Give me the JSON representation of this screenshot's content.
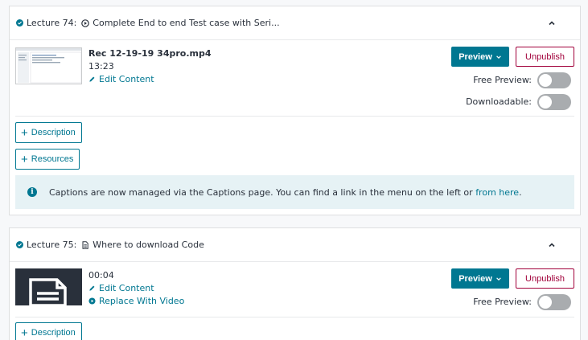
{
  "lectures": [
    {
      "number_label": "Lecture 74:",
      "title": "Complete End to end Test case with Seri...",
      "file_name": "Rec 12-19-19 34pro.mp4",
      "duration": "13:23",
      "edit_label": "Edit Content",
      "preview_label": "Preview",
      "unpublish_label": "Unpublish",
      "free_preview_label": "Free Preview:",
      "downloadable_label": "Downloadable:",
      "description_label": "Description",
      "resources_label": "Resources",
      "info": {
        "text_before": "Captions are now managed via the Captions page. You can find a link in the menu on the left or ",
        "link": "from here",
        "text_after": "."
      }
    },
    {
      "number_label": "Lecture 75:",
      "title": "Where to download Code",
      "duration": "00:04",
      "edit_label": "Edit Content",
      "replace_label": "Replace With Video",
      "preview_label": "Preview",
      "unpublish_label": "Unpublish",
      "free_preview_label": "Free Preview:",
      "description_label": "Description"
    }
  ],
  "colors": {
    "accent": "#007791",
    "danger": "#a1003a",
    "toggle_off": "#a9acaf",
    "info_bg": "#e6f2f5"
  },
  "icons": [
    "check-circle-icon",
    "play-circle-icon",
    "document-icon",
    "chevron-up-icon",
    "chevron-down-icon",
    "pencil-icon",
    "plus-icon",
    "info-icon"
  ],
  "toggles": {
    "lecture74_free_preview": false,
    "lecture74_downloadable": false,
    "lecture75_free_preview": false
  }
}
